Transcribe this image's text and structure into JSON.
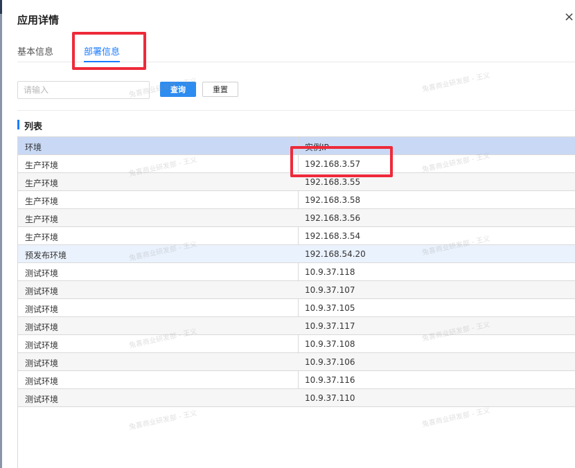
{
  "dialog": {
    "title": "应用详情",
    "close_glyph": "×"
  },
  "tabs": [
    {
      "label": "基本信息",
      "active": false
    },
    {
      "label": "部署信息",
      "active": true
    }
  ],
  "search": {
    "placeholder": "请输入",
    "value": "",
    "query_label": "查询",
    "reset_label": "重置"
  },
  "section": {
    "title": "列表"
  },
  "table": {
    "columns": [
      "环境",
      "实例IP"
    ],
    "rows": [
      {
        "env": "生产环境",
        "ip": "192.168.3.57"
      },
      {
        "env": "生产环境",
        "ip": "192.168.3.55"
      },
      {
        "env": "生产环境",
        "ip": "192.168.3.58"
      },
      {
        "env": "生产环境",
        "ip": "192.168.3.56"
      },
      {
        "env": "生产环境",
        "ip": "192.168.3.54"
      },
      {
        "env": "预发布环境",
        "ip": "192.168.54.20"
      },
      {
        "env": "测试环境",
        "ip": "10.9.37.118"
      },
      {
        "env": "测试环境",
        "ip": "10.9.37.107"
      },
      {
        "env": "测试环境",
        "ip": "10.9.37.105"
      },
      {
        "env": "测试环境",
        "ip": "10.9.37.117"
      },
      {
        "env": "测试环境",
        "ip": "10.9.37.108"
      },
      {
        "env": "测试环境",
        "ip": "10.9.37.106"
      },
      {
        "env": "测试环境",
        "ip": "10.9.37.116"
      },
      {
        "env": "测试环境",
        "ip": "10.9.37.110"
      }
    ]
  },
  "watermark": {
    "text": "兔喜商业研发部 - 王义"
  },
  "colors": {
    "accent": "#1b7cff",
    "query_button": "#2d8cf0",
    "header_bg": "#c9d9f5",
    "annotation_red": "#ee2a3a",
    "highlight_row": "#eaf2fd"
  }
}
